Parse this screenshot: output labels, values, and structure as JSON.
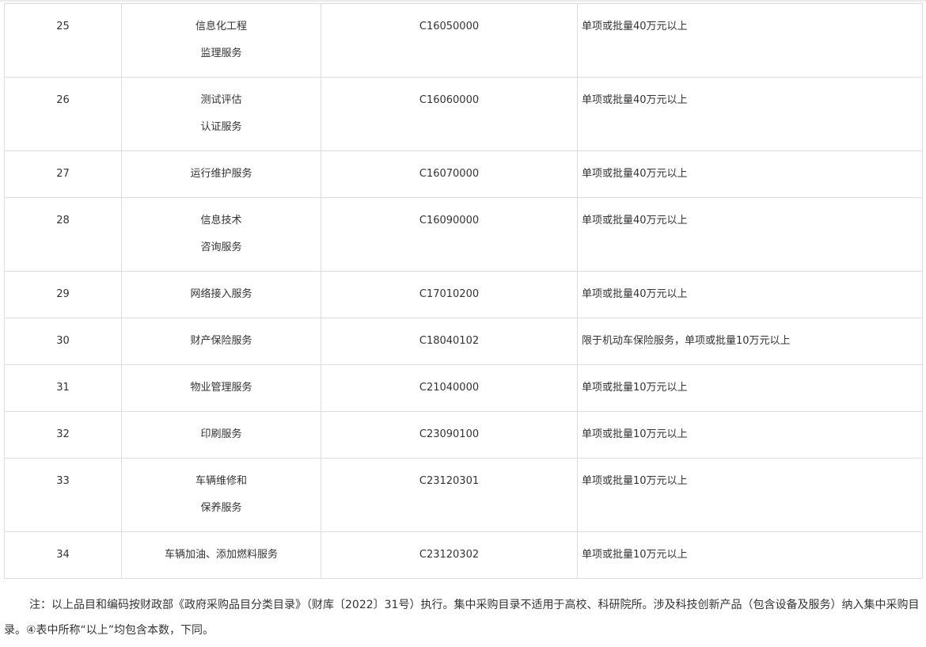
{
  "rows": [
    {
      "no": "25",
      "name": [
        "信息化工程",
        "监理服务"
      ],
      "code": "C16050000",
      "note": "单项或批量40万元以上"
    },
    {
      "no": "26",
      "name": [
        "测试评估",
        "认证服务"
      ],
      "code": "C16060000",
      "note": "单项或批量40万元以上"
    },
    {
      "no": "27",
      "name": [
        "运行维护服务"
      ],
      "code": "C16070000",
      "note": "单项或批量40万元以上"
    },
    {
      "no": "28",
      "name": [
        "信息技术",
        "咨询服务"
      ],
      "code": "C16090000",
      "note": "单项或批量40万元以上"
    },
    {
      "no": "29",
      "name": [
        "网络接入服务"
      ],
      "code": "C17010200",
      "note": "单项或批量40万元以上"
    },
    {
      "no": "30",
      "name": [
        "财产保险服务"
      ],
      "code": "C18040102",
      "note": "限于机动车保险服务，单项或批量10万元以上"
    },
    {
      "no": "31",
      "name": [
        "物业管理服务"
      ],
      "code": "C21040000",
      "note": "单项或批量10万元以上"
    },
    {
      "no": "32",
      "name": [
        "印刷服务"
      ],
      "code": "C23090100",
      "note": "单项或批量10万元以上"
    },
    {
      "no": "33",
      "name": [
        "车辆维修和",
        "保养服务"
      ],
      "code": "C23120301",
      "note": "单项或批量10万元以上"
    },
    {
      "no": "34",
      "name": [
        "车辆加油、添加燃料服务"
      ],
      "code": "C23120302",
      "note": "单项或批量10万元以上"
    }
  ],
  "footnote": "注：以上品目和编码按财政部《政府采购品目分类目录》（财库〔2022〕31号）执行。集中采购目录不适用于高校、科研院所。涉及科技创新产品（包含设备及服务）纳入集中采购目录。④表中所称“以上”均包含本数，下同。"
}
